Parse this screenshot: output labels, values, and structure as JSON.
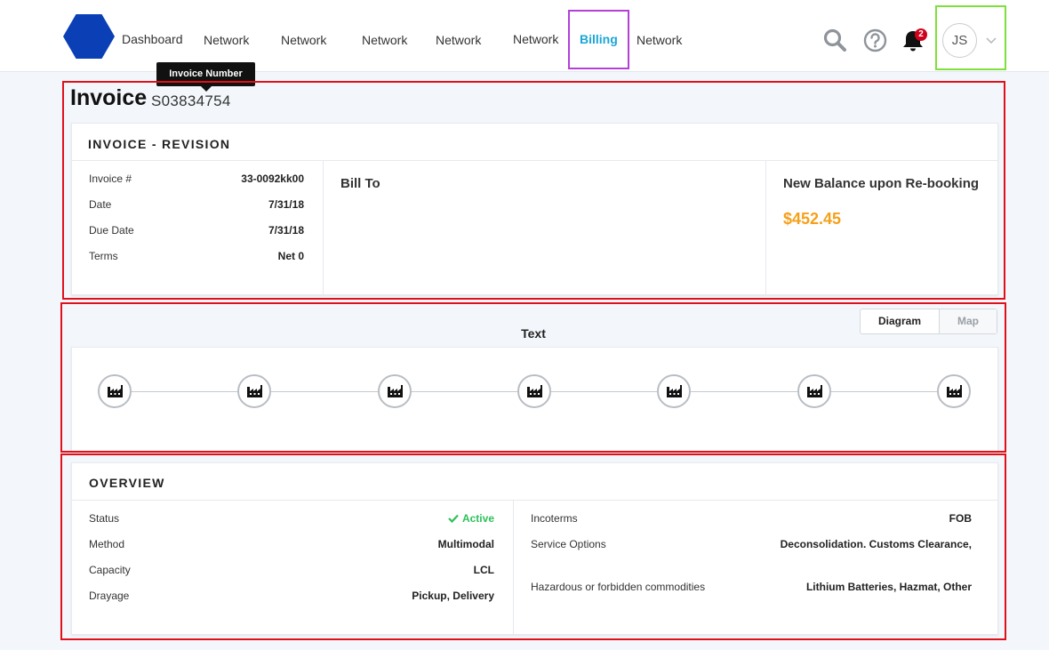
{
  "header": {
    "nav": [
      {
        "label": "Dashboard"
      },
      {
        "label": "Network"
      },
      {
        "label": "Network"
      },
      {
        "label": "Network"
      },
      {
        "label": "Network"
      },
      {
        "label": "Network"
      },
      {
        "label": "Billing",
        "active": true
      },
      {
        "label": "Network"
      }
    ],
    "notification_count": "2",
    "user_initials": "JS",
    "icons": [
      "logo-hexagon-icon",
      "search-icon",
      "help-icon",
      "bell-icon",
      "chevron-down-icon"
    ]
  },
  "tooltip": {
    "text": "Invoice Number"
  },
  "invoice": {
    "title": "Invoice",
    "number": "S03834754",
    "card_title": "INVOICE - REVISION",
    "fields": [
      {
        "label": "Invoice #",
        "value": "33-0092kk00"
      },
      {
        "label": "Date",
        "value": "7/31/18"
      },
      {
        "label": "Due Date",
        "value": "7/31/18"
      },
      {
        "label": "Terms",
        "value": "Net 0"
      }
    ],
    "bill_to_label": "Bill To",
    "balance_label": "New Balance upon Re-booking",
    "balance_value": "$452.45"
  },
  "route": {
    "title": "Text",
    "toggle": {
      "diagram": "Diagram",
      "map": "Map",
      "selected": "Diagram"
    },
    "node_icon": "factory-icon",
    "node_count": 7
  },
  "overview": {
    "title": "OVERVIEW",
    "left": [
      {
        "label": "Status",
        "value": "Active"
      },
      {
        "label": "Method",
        "value": "Multimodal"
      },
      {
        "label": "Capacity",
        "value": "LCL"
      },
      {
        "label": "Drayage",
        "value": "Pickup, Delivery"
      }
    ],
    "right": [
      {
        "label": "Incoterms",
        "value": "FOB"
      },
      {
        "label": "Service Options",
        "value": "Deconsolidation. Customs Clearance,"
      },
      {
        "label": "Hazardous or forbidden commodities",
        "value": "Lithium Batteries, Hazmat, Other"
      }
    ]
  },
  "colors": {
    "brand_blue": "#0a3fb5",
    "active_nav": "#1aa6d6",
    "balance_orange": "#f5a01a",
    "status_green": "#2ec15a",
    "notification_red": "#d0021b"
  }
}
